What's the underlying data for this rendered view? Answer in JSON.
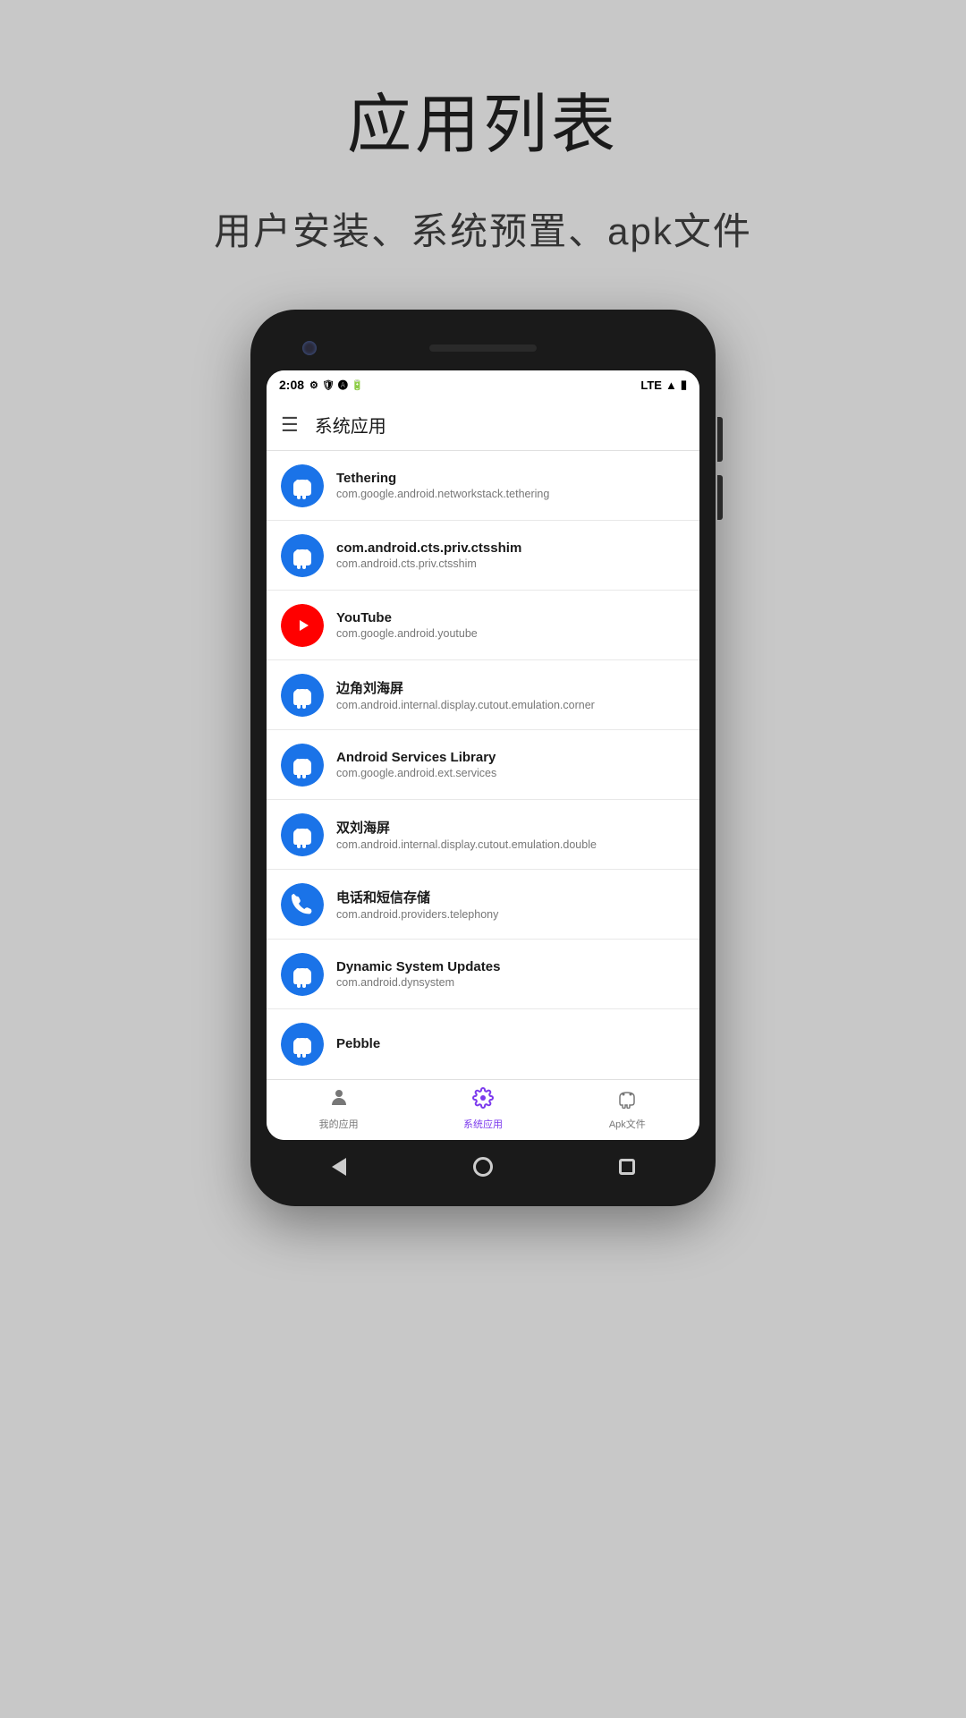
{
  "page": {
    "title": "应用列表",
    "subtitle": "用户安装、系统预置、apk文件"
  },
  "status_bar": {
    "time": "2:08",
    "network": "LTE"
  },
  "app_header": {
    "title": "系统应用"
  },
  "apps": [
    {
      "name": "Tethering",
      "package": "com.google.android.networkstack.tethering",
      "icon_type": "android"
    },
    {
      "name": "com.android.cts.priv.ctsshim",
      "package": "com.android.cts.priv.ctsshim",
      "icon_type": "android"
    },
    {
      "name": "YouTube",
      "package": "com.google.android.youtube",
      "icon_type": "youtube"
    },
    {
      "name": "边角刘海屏",
      "package": "com.android.internal.display.cutout.emulation.corner",
      "icon_type": "android"
    },
    {
      "name": "Android Services Library",
      "package": "com.google.android.ext.services",
      "icon_type": "android"
    },
    {
      "name": "双刘海屏",
      "package": "com.android.internal.display.cutout.emulation.double",
      "icon_type": "android"
    },
    {
      "name": "电话和短信存储",
      "package": "com.android.providers.telephony",
      "icon_type": "phone"
    },
    {
      "name": "Dynamic System Updates",
      "package": "com.android.dynsystem",
      "icon_type": "android"
    },
    {
      "name": "Pebble",
      "package": "",
      "icon_type": "android"
    }
  ],
  "bottom_nav": {
    "items": [
      {
        "label": "我的应用",
        "icon": "person",
        "active": false
      },
      {
        "label": "系统应用",
        "icon": "gear",
        "active": true
      },
      {
        "label": "Apk文件",
        "icon": "android",
        "active": false
      }
    ]
  }
}
